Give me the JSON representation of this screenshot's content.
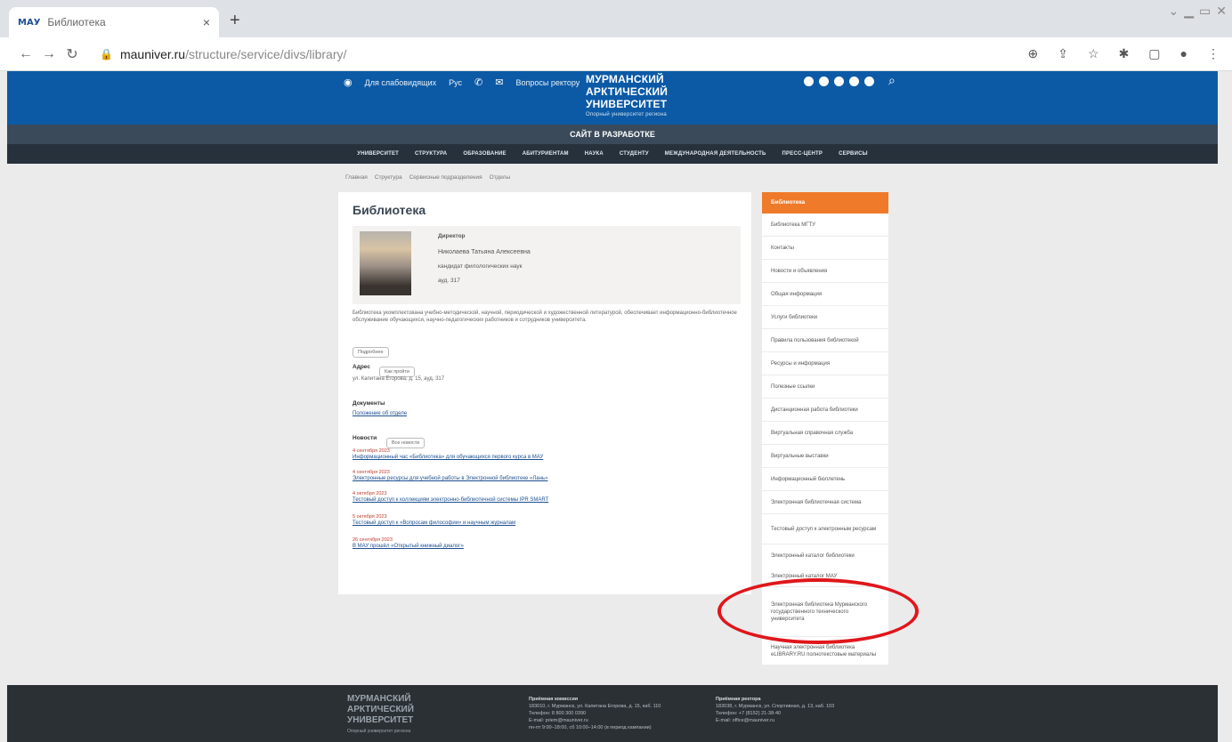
{
  "browser": {
    "tab_title": "Библиотека",
    "tab_favicon": "МАУ",
    "url_host": "mauniver.ru",
    "url_path": "/structure/service/divs/library/"
  },
  "site": {
    "tools": [
      "Для слабовидящих",
      "Рус",
      "Вопросы ректору"
    ],
    "logo_lines": [
      "МУРМАНСКИЙ",
      "АРКТИЧЕСКИЙ",
      "УНИВЕРСИТЕТ"
    ],
    "logo_sub": "Опорный университет региона",
    "dev_notice": "САЙТ В РАЗРАБОТКЕ",
    "menu": [
      "УНИВЕРСИТЕТ",
      "СТРУКТУРА",
      "ОБРАЗОВАНИЕ",
      "АБИТУРИЕНТАМ",
      "НАУКА",
      "СТУДЕНТУ",
      "МЕЖДУНАРОДНАЯ ДЕЯТЕЛЬНОСТЬ",
      "ПРЕСС-ЦЕНТР",
      "СЕРВИСЫ"
    ]
  },
  "breadcrumbs": [
    "Главная",
    "Структура",
    "Сервисные подразделения",
    "Отделы"
  ],
  "main": {
    "title": "Библиотека",
    "person": {
      "role": "Директор",
      "name": "Николаева Татьяна Алексеевна",
      "position": "кандидат филологических наук",
      "room": "ауд. 317"
    },
    "description": "Библиотека укомплектована учебно-методической, научной, периодической и художественной литературой, обеспечивает информационно-библиотечное обслуживание обучающихся, научно-педагогических работников и сотрудников университета.",
    "more_btn": "Подробнее",
    "address_label": "Адрес",
    "address_pill": "Как пройти",
    "address_value": "ул. Капитана Егорова, д. 15, ауд. 317",
    "docs_label": "Документы",
    "docs_link": "Положение об отделе",
    "news_label": "Новости",
    "news_pill": "Все новости",
    "news": [
      {
        "date": "4 сентября 2023",
        "title": "Информационный час «Библиотека» для обучающихся первого курса в МАУ"
      },
      {
        "date": "4 сентября 2023",
        "title": "Электронные ресурсы для учебной работы в Электронной библиотеке «Лань»"
      },
      {
        "date": "4 октября 2023",
        "title": "Тестовый доступ к коллекциям электронно-библиотечной системы IPR SMART"
      },
      {
        "date": "5 октября 2023",
        "title": "Тестовый доступ к «Вопросам философии» и научным журналам"
      },
      {
        "date": "26 сентября 2023",
        "title": "В МАУ прошёл «Открытый книжный диалог»"
      }
    ]
  },
  "sidebar": {
    "header": "Библиотека",
    "items": [
      "Библиотека МГТУ",
      "Контакты",
      "Новости и объявления",
      "Общая информация",
      "Услуги библиотеки",
      "Правила пользования библиотекой",
      "Ресурсы и информация",
      "Полезные ссылки",
      "Дистанционная работа библиотеки",
      "Виртуальная справочная служба",
      "Виртуальные выставки",
      "Информационный бюллетень",
      "Электронная библиотечная система",
      "Тестовый доступ к электронным ресурсам",
      "Электронный каталог библиотеки"
    ],
    "items2": [
      "Электронный каталог МАУ",
      "Электронная библиотека Мурманского государственного технического университета",
      "Научная электронная библиотека eLIBRARY.RU полнотекстовые материалы"
    ]
  },
  "footer": {
    "logo_lines": [
      "МУРМАНСКИЙ",
      "АРКТИЧЕСКИЙ",
      "УНИВЕРСИТЕТ"
    ],
    "logo_sub": "Опорный университет региона",
    "col1_title": "Приёмная комиссия",
    "col1_lines": [
      "183010, г. Мурманск, ул. Капитана Егорова, д. 15, каб. 110",
      "Телефон: 8 800 300 0390",
      "E-mail: priem@mauniver.ru",
      "пн-пт 9:00–18:00, сб 10:00–14:00 (в период кампании)"
    ],
    "col2_title": "Приёмная ректора",
    "col2_lines": [
      "183038, г. Мурманск, ул. Спортивная, д. 13, каб. 103",
      "Телефон: +7 (8152) 21-38-40",
      "E-mail: office@mauniver.ru"
    ]
  }
}
